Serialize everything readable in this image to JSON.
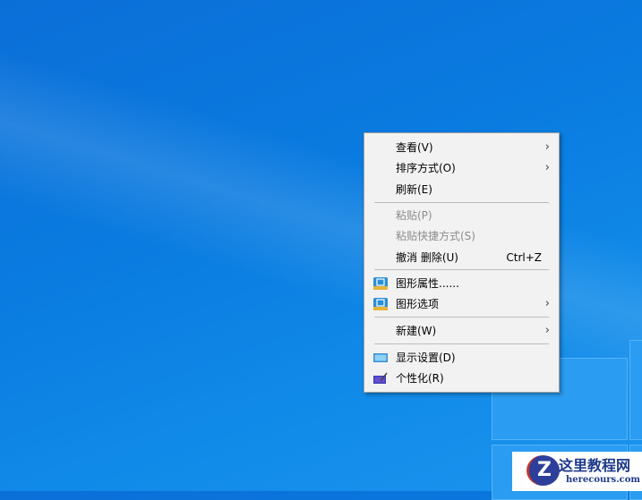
{
  "menu": {
    "items": [
      {
        "label": "查看(V)",
        "submenu": true
      },
      {
        "label": "排序方式(O)",
        "submenu": true
      },
      {
        "label": "刷新(E)"
      },
      {
        "label": "粘贴(P)",
        "disabled": true
      },
      {
        "label": "粘贴快捷方式(S)",
        "disabled": true
      },
      {
        "label": "撤消 删除(U)",
        "shortcut": "Ctrl+Z"
      },
      {
        "label": "图形属性......",
        "icon": "intel-graphics-icon"
      },
      {
        "label": "图形选项",
        "icon": "intel-graphics-icon",
        "submenu": true
      },
      {
        "label": "新建(W)",
        "submenu": true
      },
      {
        "label": "显示设置(D)",
        "icon": "display-icon"
      },
      {
        "label": "个性化(R)",
        "icon": "personalize-icon"
      }
    ],
    "arrow": "›"
  },
  "watermark": {
    "title": "这里教程网",
    "url": "herecours.com",
    "logo": "Z"
  }
}
